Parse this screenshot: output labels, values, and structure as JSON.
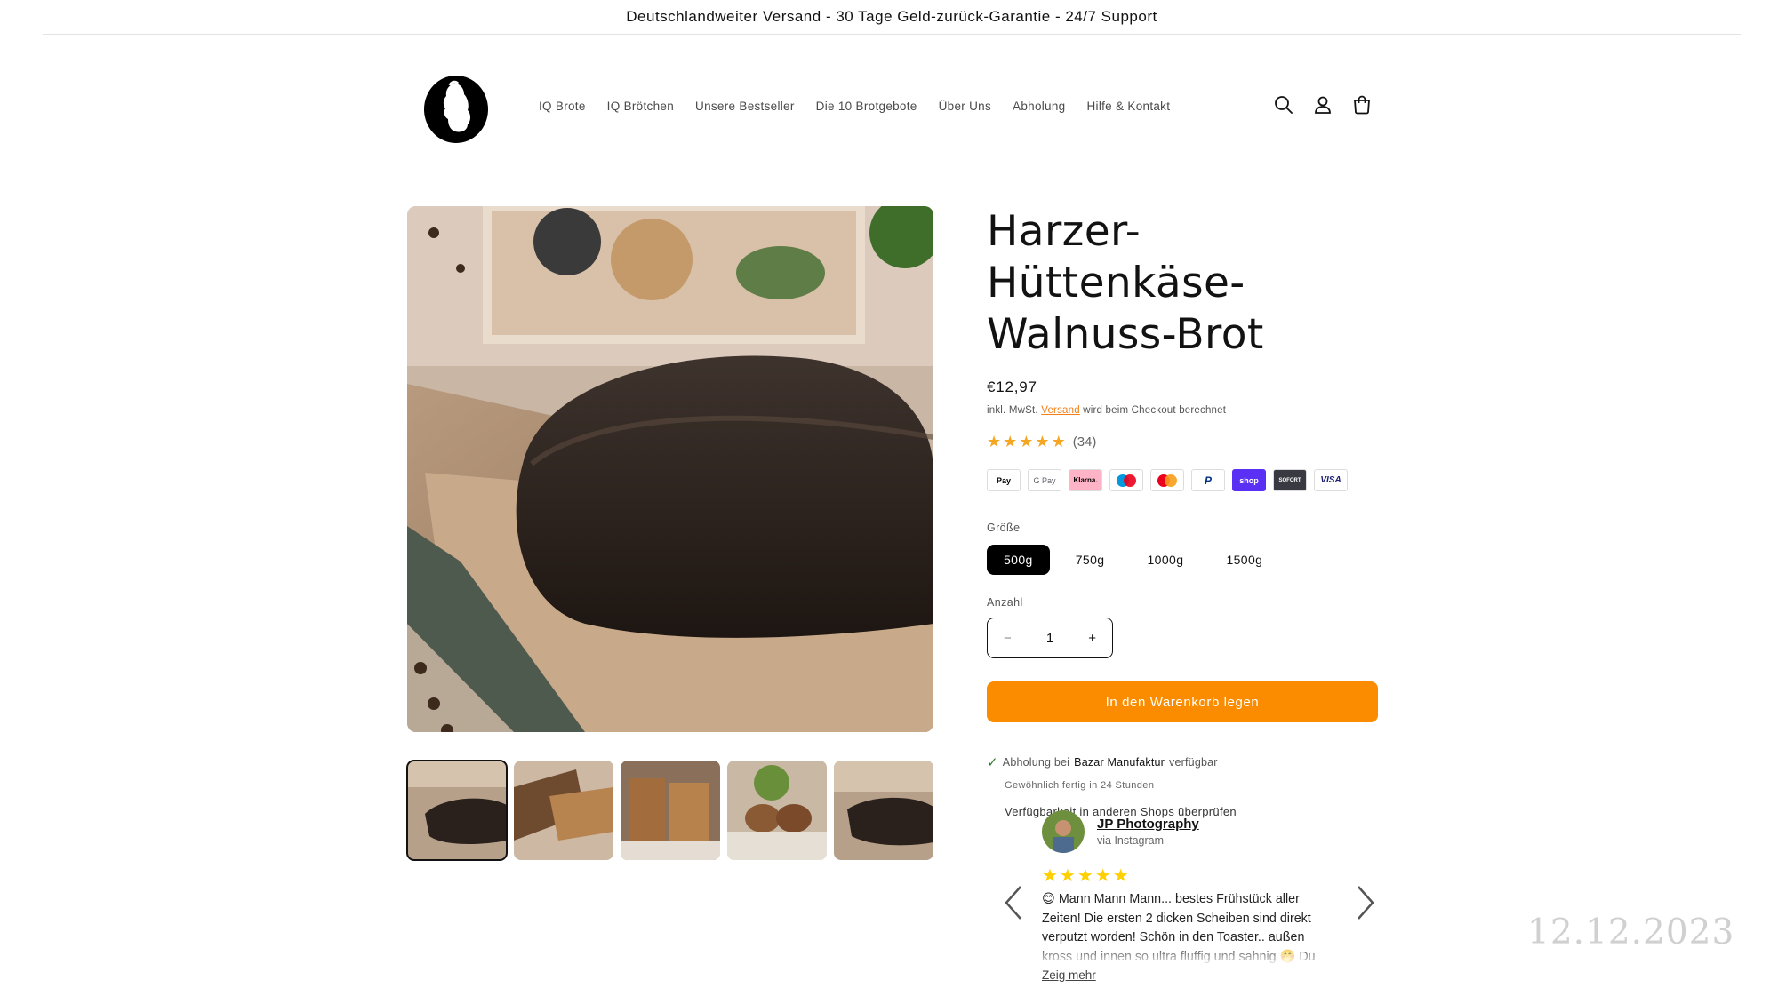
{
  "announcement": "Deutschlandweiter Versand - 30 Tage Geld-zurück-Garantie - 24/7 Support",
  "nav": {
    "items": [
      "IQ Brote",
      "IQ Brötchen",
      "Unsere Bestseller",
      "Die 10 Brotgebote",
      "Über Uns",
      "Abholung",
      "Hilfe & Kontakt"
    ]
  },
  "header_icons": [
    "search-icon",
    "account-icon",
    "cart-icon"
  ],
  "product": {
    "title": "Harzer-Hüttenkäse-Walnuss-Brot",
    "price": "€12,97",
    "tax_prefix": "inkl. MwSt.",
    "tax_link": "Versand",
    "tax_suffix": "wird beim Checkout berechnet",
    "rating_count": "(34)",
    "rating": 5,
    "payments": [
      "Pay",
      "G Pay",
      "Klarna.",
      "maestro",
      "mastercard",
      "P",
      "shop",
      "SOFORT",
      "VISA"
    ],
    "size_label": "Größe",
    "sizes": [
      "500g",
      "750g",
      "1000g",
      "1500g"
    ],
    "selected_size": "500g",
    "qty_label": "Anzahl",
    "qty_minus": "−",
    "qty_value": "1",
    "qty_plus": "+",
    "cart_button": "In den Warenkorb legen"
  },
  "pickup": {
    "prefix": "Abholung bei",
    "location": "Bazar Manufaktur",
    "suffix": "verfügbar",
    "sub": "Gewöhnlich fertig in 24 Stunden",
    "link": "Verfügbarkeit in anderen Shops überprüfen"
  },
  "review": {
    "name": "JP Photography",
    "via": "via Instagram",
    "stars": "★★★★★",
    "text": "😊 Mann Mann Mann... bestes Frühstück aller Zeiten! Die ersten 2 dicken Scheiben sind direkt verputzt worden! Schön in den Toaster.. außen kross und innen so ultra fluffig und sahnig 🤭 Du",
    "more": "Zeig mehr"
  },
  "date_stamp": "12.12.2023",
  "colors": {
    "accent": "#fb8c00",
    "link": "#f57f17",
    "text": "#121212",
    "stars": "#f5a623",
    "review_stars": "#ffd000"
  }
}
